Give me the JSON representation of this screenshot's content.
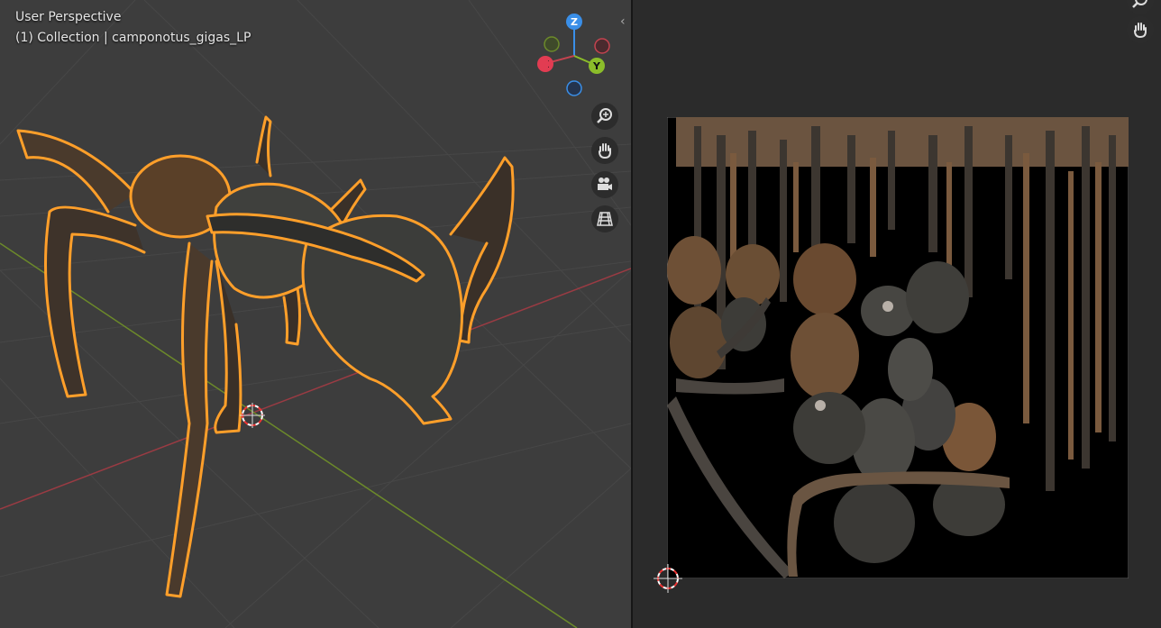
{
  "viewport": {
    "view_label": "User Perspective",
    "collection_label": "(1) Collection | camponotus_gigas_LP",
    "gizmo": {
      "z": "Z",
      "y": "Y",
      "x": "X"
    },
    "nav_buttons": [
      "zoom-icon",
      "hand-icon",
      "camera-icon",
      "grid-icon"
    ],
    "collapse_glyph": "‹"
  },
  "uv_editor": {
    "tool_buttons": [
      "search-icon",
      "hand-icon"
    ]
  },
  "colors": {
    "axis_x": "#c4434f",
    "axis_y": "#8bbd2a",
    "axis_z": "#3a8fe8",
    "selection_outline": "#ff9f2a",
    "viewport_bg": "#3d3d3d",
    "uv_bg": "#2b2b2b"
  }
}
